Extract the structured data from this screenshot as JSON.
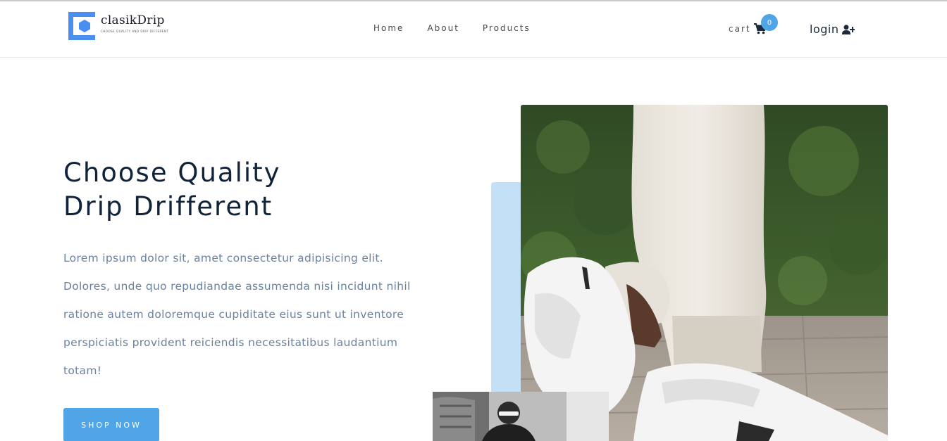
{
  "brand": {
    "name": "clasikDrip",
    "tagline": "CHOOSE QUALITY AND DRIP DIFFERENT",
    "accent_color": "#4fa5e6",
    "logo_color": "#4a8ef0"
  },
  "nav": {
    "items": [
      {
        "label": "Home"
      },
      {
        "label": "About"
      },
      {
        "label": "Products"
      }
    ]
  },
  "cart": {
    "label": "cart",
    "count": "0",
    "icon": "shopping-cart-icon"
  },
  "login": {
    "label": "login",
    "icon": "user-plus-icon"
  },
  "hero": {
    "title_line1": "Choose Quality",
    "title_line2": "Drip Drifferent",
    "description": "Lorem ipsum dolor sit, amet consectetur adipisicing elit. Dolores, unde quo repudiandae assumenda nisi incidunt nihil ratione autem doloremque cupiditate eius sunt ut inventore perspiciatis provident reiciendis necessitatibus laudantium totam!",
    "button_label": "SHOP NOW"
  }
}
